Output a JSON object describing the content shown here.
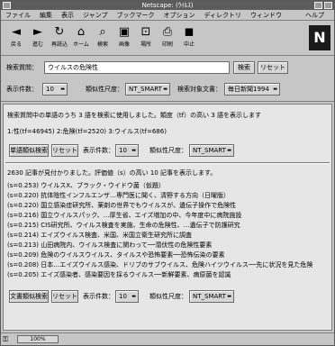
{
  "window": {
    "title": "Netscape: (ｳｲﾙｽ)"
  },
  "menu": [
    "ファイル",
    "編集",
    "表示",
    "ジャンプ",
    "ブックマーク",
    "オプション",
    "ディレクトリ",
    "ウィンドウ"
  ],
  "menu_help": "ヘルプ",
  "toolbar": [
    {
      "icon": "back-icon",
      "glyph": "◄",
      "label": "戻る"
    },
    {
      "icon": "forward-icon",
      "glyph": "►",
      "label": "進む"
    },
    {
      "icon": "reload-icon",
      "glyph": "↻",
      "label": "再読込"
    },
    {
      "icon": "home-icon",
      "glyph": "⌂",
      "label": "ホーム"
    },
    {
      "icon": "search-icon",
      "glyph": "⌕",
      "label": "検索"
    },
    {
      "icon": "images-icon",
      "glyph": "▣",
      "label": "画像"
    },
    {
      "icon": "open-icon",
      "glyph": "⊡",
      "label": "場所"
    },
    {
      "icon": "print-icon",
      "glyph": "⎙",
      "label": "印刷"
    },
    {
      "icon": "stop-icon",
      "glyph": "◼",
      "label": "中止"
    }
  ],
  "logo": "N",
  "search": {
    "label": "検索質問：",
    "query": "ウイルスの危険性",
    "submit": "検索",
    "reset": "リセット",
    "count_label": "表示件数：",
    "count_value": "10",
    "sim_label": "類似性尺度：",
    "sim_value": "NT_SMART",
    "target_label": "検索対象文書：",
    "target_value": "毎日新聞1994"
  },
  "results": {
    "phrase_line": "検索質問中の単語のうち 3 語を検索に使用しました。類度（tf）の高い 3 語を表示します",
    "terms_line": "1:性(tf=46945) 2:危険(tf=2520) 3:ウイルス(tf=686)",
    "mid_controls": {
      "sim_button": "単語類似検索",
      "reset": "リセット",
      "count_label": "表示件数：",
      "count_value": "10",
      "sim_label": "類似性尺度：",
      "sim_value": "NT_SMART"
    },
    "summary": "2630 記事が見付かりました。評価値（s）の高い 10 記事を表示します。",
    "items": [
      "(s=0.253) ウイルスX、ブラック・ウイドウ菌（仮題）",
      "(s=0.220) 抗体陰性インフルエンザ…専門医に聞く、清野する方向（日曜版）",
      "(s=0.220) 国立感染症研究所、薬剤の世界でもウイルスが、遺伝子操作で危険性",
      "(s=0.216) 国立ウイルスパック、…厚生省、エイズ増加の中、今年度中に病院施設",
      "(s=0.215) CIS研究所、ウイルス検査を実施、生命の危険性、…遺伝子で防護研究",
      "(s=0.214) エイズウイルス検査、米国、米国立衛生研究所に調査",
      "(s=0.213) 山田病院内、ウイルス検査に関わって──潜伏性の危険性要素",
      "(s=0.209) 危険のウイルスウイルス、タイルスや恐怖要素──恐怖伝染の要素",
      "(s=0.208) 日本…エイズウイルス感染、ドリブのサブウイルス、危険ハイツウイルス──先に状況を見た危険",
      "(s=0.205) エイズ感染者、感染要因を採るウイルス──新鮮要素、病原菌を認識"
    ],
    "bottom_controls": {
      "sim_button": "文書類似検索",
      "reset": "リセット",
      "count_label": "表示件数：",
      "count_value": "10",
      "sim_label": "類似性尺度：",
      "sim_value": "NT_SMART"
    }
  },
  "status": {
    "progress": "100%"
  }
}
